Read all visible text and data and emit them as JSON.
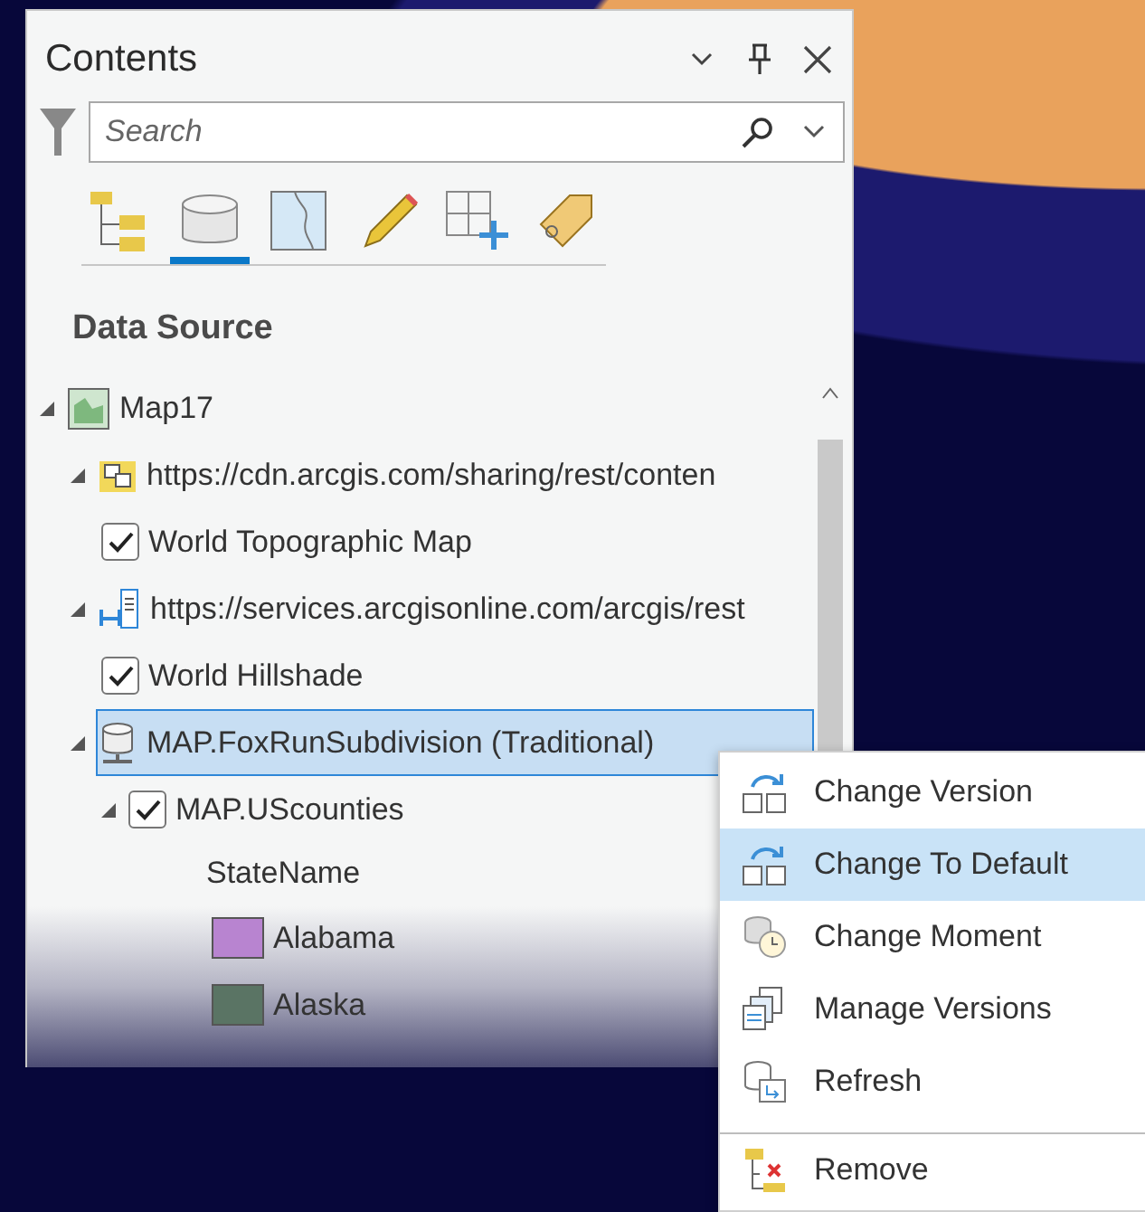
{
  "pane": {
    "title": "Contents"
  },
  "search": {
    "placeholder": "Search"
  },
  "tabs": [
    {
      "kind": "drawing-order",
      "selected": false
    },
    {
      "kind": "data-source",
      "selected": true
    },
    {
      "kind": "selection",
      "selected": false
    },
    {
      "kind": "editing",
      "selected": false
    },
    {
      "kind": "snapping",
      "selected": false
    },
    {
      "kind": "labeling",
      "selected": false
    }
  ],
  "section_title": "Data Source",
  "tree": [
    {
      "kind": "map",
      "label": "Map17",
      "expanded": true,
      "selected": false,
      "children": [
        {
          "kind": "tile-service",
          "label": "https://cdn.arcgis.com/sharing/rest/conten",
          "expanded": true,
          "selected": false,
          "children": [
            {
              "kind": "layer",
              "label": "World Topographic Map",
              "checked": true
            }
          ]
        },
        {
          "kind": "map-service",
          "label": "https://services.arcgisonline.com/arcgis/rest",
          "expanded": true,
          "selected": false,
          "children": [
            {
              "kind": "layer",
              "label": "World Hillshade",
              "checked": true
            }
          ]
        },
        {
          "kind": "database",
          "label": "MAP.FoxRunSubdivision (Traditional)",
          "expanded": true,
          "selected": true,
          "children": [
            {
              "kind": "layer",
              "label": "MAP.UScounties",
              "checked": true,
              "expanded": true,
              "children": [
                {
                  "kind": "heading",
                  "label": "StateName"
                },
                {
                  "kind": "symbol",
                  "label": "Alabama",
                  "color": "#b884d0"
                },
                {
                  "kind": "symbol",
                  "label": "Alaska",
                  "color": "#5a7464"
                }
              ]
            }
          ]
        }
      ]
    }
  ],
  "context_menu": [
    {
      "kind": "change-version",
      "label": "Change Version",
      "selected": false,
      "separator_before": false
    },
    {
      "kind": "change-version",
      "label": "Change To Default",
      "selected": true,
      "separator_before": false
    },
    {
      "kind": "moment",
      "label": "Change Moment",
      "selected": false,
      "separator_before": false
    },
    {
      "kind": "manage",
      "label": "Manage Versions",
      "selected": false,
      "separator_before": false
    },
    {
      "kind": "refresh",
      "label": "Refresh",
      "selected": false,
      "separator_before": false
    },
    {
      "kind": "remove",
      "label": "Remove",
      "selected": false,
      "separator_before": true
    }
  ]
}
